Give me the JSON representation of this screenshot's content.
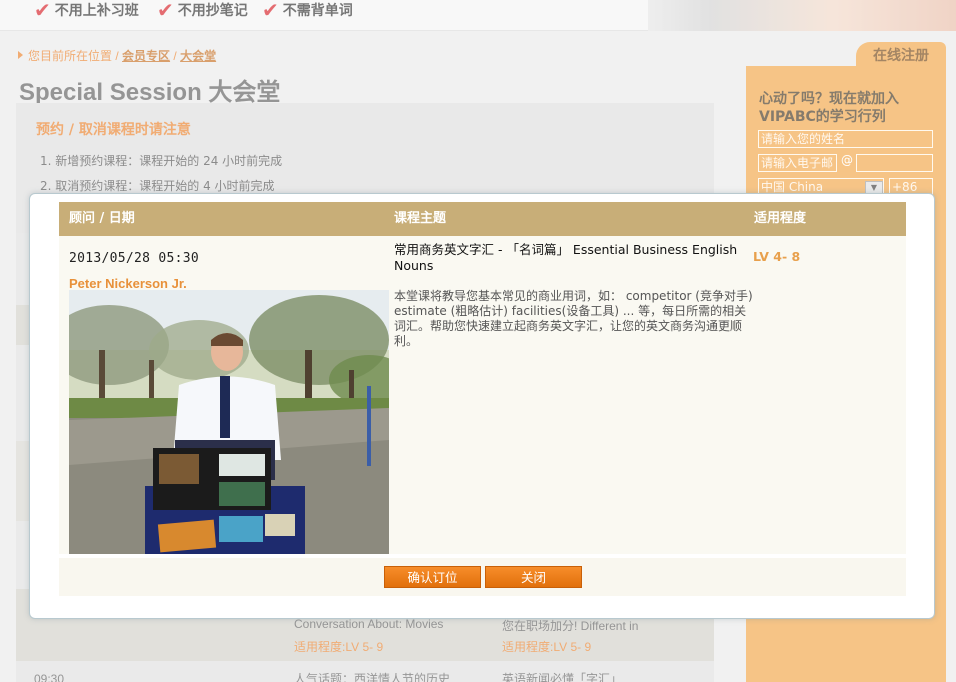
{
  "banner": {
    "slogans": [
      "不用上补习班",
      "不用抄笔记",
      "不需背单词"
    ]
  },
  "breadcrumb": {
    "prefix": "您目前所在位置",
    "sep": "/",
    "member_area": "会员专区",
    "current": "大会堂"
  },
  "page_title": "Special Session 大会堂",
  "notice": {
    "title": "预约 / 取消课程时请注意",
    "items": [
      "1.  新增预约课程：课程开始的 24 小时前完成",
      "2.  取消预约课程：课程开始的 4 小时前完成"
    ]
  },
  "background_table": {
    "row_a": {
      "course_1": "Conversation About: Movies",
      "course_2": "您在职场加分! Different in",
      "level_1": "适用程度:LV 5- 9",
      "level_2": "适用程度:LV 5- 9"
    },
    "row_b": {
      "time": "09:30",
      "course_1": "人气话题：西洋情人节的历史",
      "course_2": "英语新闻必懂「字汇」"
    }
  },
  "sidebar": {
    "tab": "在线注册",
    "headline": "心动了吗？现在就加入VIPABC的学习行列",
    "name_placeholder": "请输入您的姓名",
    "email_placeholder": "请输入电子邮",
    "at_sign": "@",
    "country": "中国 China",
    "dropdown_arrow": "▼",
    "phone_code": "+86"
  },
  "modal": {
    "headers": {
      "consultant_date": "顾问 / 日期",
      "topic": "课程主题",
      "level": "适用程度"
    },
    "session": {
      "datetime": "2013/05/28 05:30",
      "consultant": "Peter Nickerson Jr.",
      "course_title": "常用商务英文字汇 - 「名词篇」 Essential Business English Nouns",
      "description": "本堂课将教导您基本常见的商业用词，如： competitor (竞争对手) estimate (粗略估计) facilities(设备工具) ... 等，每日所需的相关词汇。帮助您快速建立起商务英文字汇，让您的英文商务沟通更顺利。",
      "level": "LV 4- 8"
    },
    "buttons": {
      "confirm": "确认订位",
      "close": "关闭"
    }
  },
  "colors": {
    "accent": "#e8791e",
    "header_tan": "#c8ae78",
    "sidebar_orange": "#f0a03c",
    "button_orange": "#f07e1a"
  }
}
